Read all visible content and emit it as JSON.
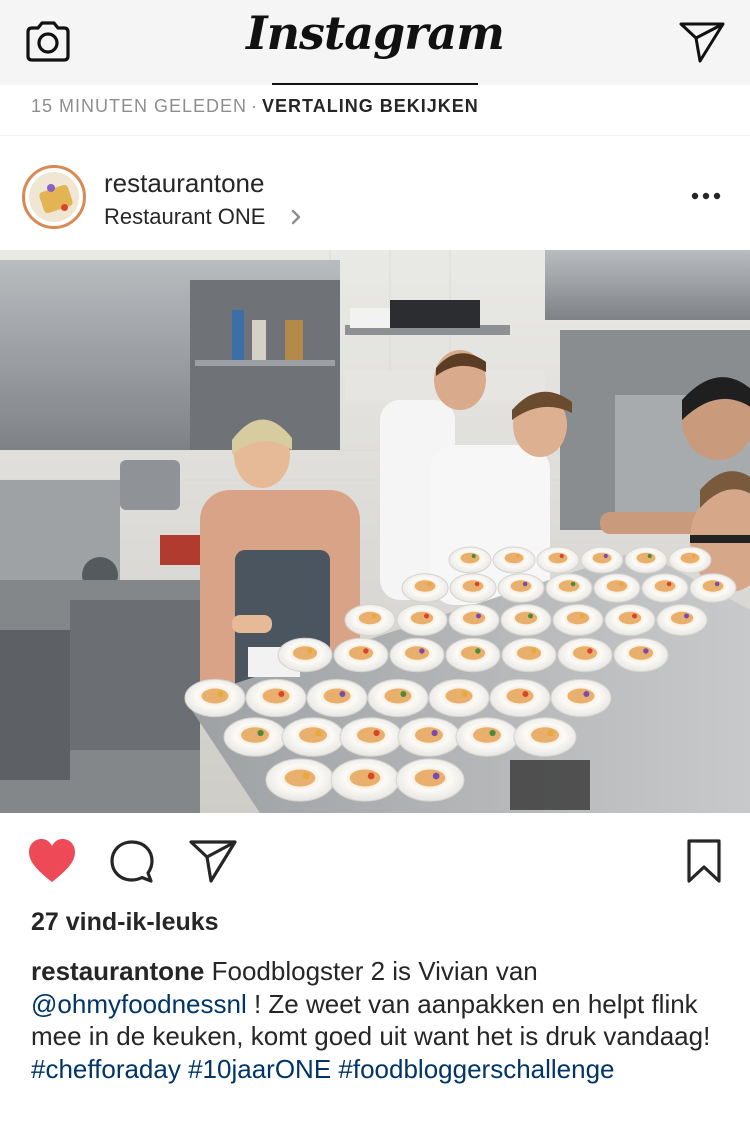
{
  "app": {
    "title": "Instagram"
  },
  "post": {
    "time_ago": "15 MINUTEN GELEDEN",
    "separator": "·",
    "translate_label": "VERTALING BEKIJKEN",
    "username": "restaurantone",
    "location": "Restaurant ONE",
    "likes": "27 vind-ik-leuks",
    "caption": {
      "username": "restaurantone",
      "text_1": " Foodblogster 2 is Vivian van ",
      "mention": "@ohmyfoodnessnl",
      "text_2": " ! Ze weet van aanpakken en helpt flink mee in de keuken, komt goed uit want  het is druk vandaag!",
      "hashtags": [
        "#chefforaday",
        "#10jaarONE",
        "#foodbloggerschallenge"
      ]
    },
    "liked": true
  },
  "icons": {
    "camera": "camera-icon",
    "direct": "direct-message-icon",
    "like": "heart-icon",
    "comment": "comment-icon",
    "share": "share-icon",
    "save": "bookmark-icon",
    "more": "more-options-icon"
  },
  "colors": {
    "like": "#ed4956",
    "link": "#003569",
    "muted": "#8e8e8e",
    "avatar_ring": "#d88a52"
  }
}
